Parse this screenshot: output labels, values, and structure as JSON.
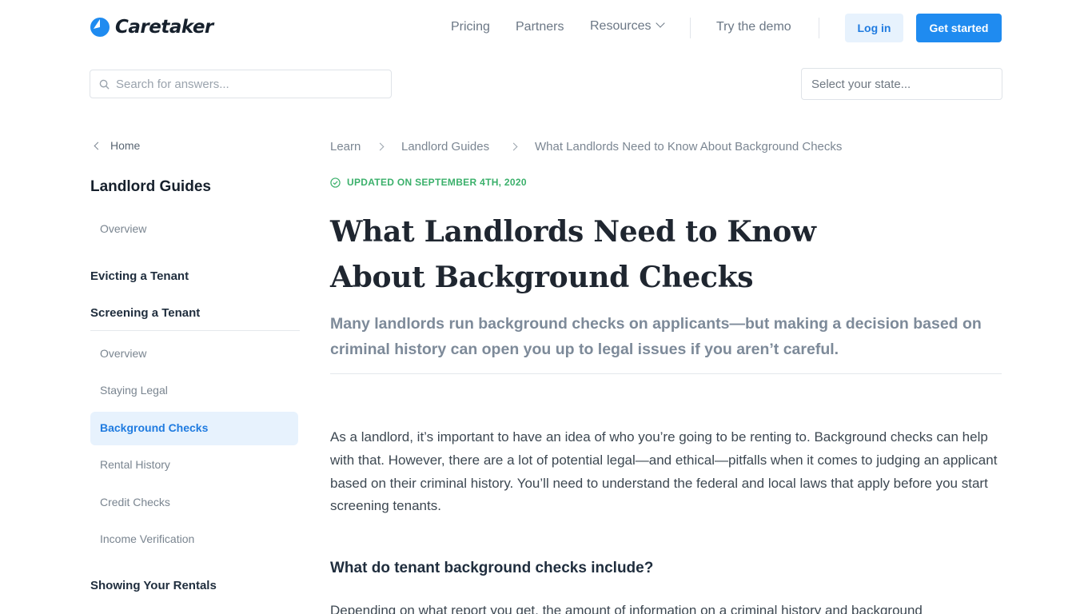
{
  "header": {
    "brand": "Caretaker",
    "nav": {
      "pricing": "Pricing",
      "partners": "Partners",
      "resources": "Resources",
      "demo": "Try the demo"
    },
    "login": "Log in",
    "get_started": "Get started",
    "brand_color": "#1f8bf0"
  },
  "search": {
    "placeholder": "Search for answers...",
    "state_placeholder": "Select your state..."
  },
  "sidebar": {
    "home": "Home",
    "title": "Landlord Guides",
    "overview_top": "Overview",
    "evicting": "Evicting a Tenant",
    "screening": "Screening a Tenant",
    "items": [
      "Overview",
      "Staying Legal",
      "Background Checks",
      "Rental History",
      "Credit Checks",
      "Income Verification"
    ],
    "active_item": "Background Checks",
    "showing": "Showing Your Rentals"
  },
  "breadcrumb": [
    "Learn",
    "Landlord Guides",
    "What Landlords Need to Know About Background Checks"
  ],
  "article": {
    "updated": "UPDATED ON SEPTEMBER 4TH, 2020",
    "title": "What Landlords Need to Know About Background Checks",
    "subtitle": "Many landlords run background checks on applicants—but making a decision based on criminal history can open you up to legal issues if you aren’t careful.",
    "intro": "As a landlord, it’s important to have an idea of who you’re going to be renting to. Background checks can help with that. However, there are a lot of potential legal—and ethical—pitfalls when it comes to judging an applicant based on their criminal history. You’ll need to understand the federal and local laws that apply before you start screening tenants.",
    "heading": "What do tenant background checks include?",
    "next_para": "Depending on what report you get, the amount of information on a criminal history and background"
  }
}
